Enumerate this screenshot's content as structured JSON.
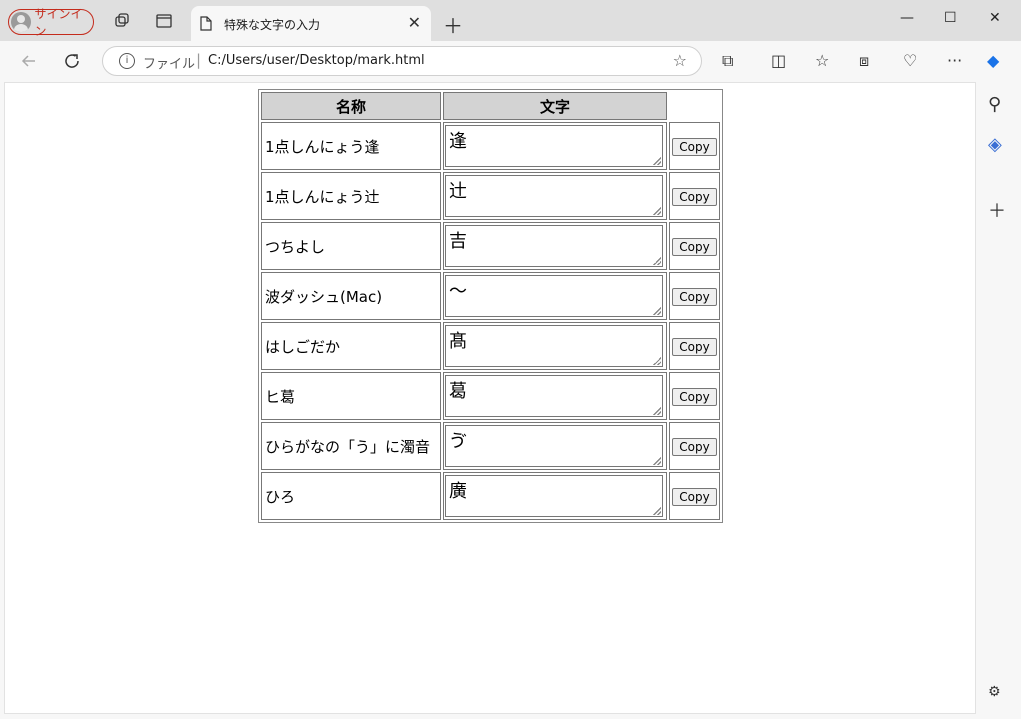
{
  "browser": {
    "profile_label": "サインイン",
    "tab_title": "特殊な文字の入力",
    "address_scheme": "ファイル",
    "address_url": "C:/Users/user/Desktop/mark.html"
  },
  "table": {
    "headers": [
      "名称",
      "文字"
    ],
    "button_label": "Copy",
    "rows": [
      {
        "name": "1点しんにょう逢",
        "char": "逢"
      },
      {
        "name": "1点しんにょう辻",
        "char": "辻"
      },
      {
        "name": "つちよし",
        "char": "吉"
      },
      {
        "name": "波ダッシュ(Mac)",
        "char": "〜"
      },
      {
        "name": "はしごだか",
        "char": "髙"
      },
      {
        "name": "ヒ葛",
        "char": "葛"
      },
      {
        "name": "ひらがなの「う」に濁音",
        "char": "ゔ"
      },
      {
        "name": "ひろ",
        "char": "廣"
      }
    ]
  }
}
